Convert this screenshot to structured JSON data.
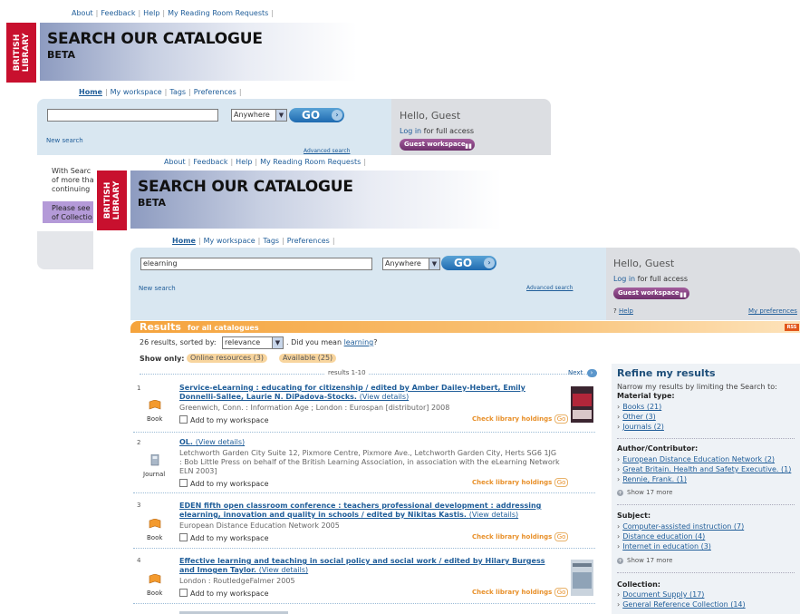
{
  "top_links": [
    "About",
    "Feedback",
    "Help",
    "My Reading Room Requests"
  ],
  "logo_text": "BRITISH LIBRARY",
  "banner": {
    "title": "SEARCH OUR CATALOGUE",
    "subtitle": "BETA"
  },
  "nav": [
    "Home",
    "My workspace",
    "Tags",
    "Preferences"
  ],
  "background_window": {
    "search_value": "",
    "scope_value": "Anywhere",
    "go_label": "GO",
    "new_search": "New search",
    "advanced_search": "Advanced search",
    "hello": "Hello, Guest",
    "login_link": "Log in",
    "login_suffix": " for full access",
    "guest_workspace": "Guest workspace",
    "intro_lines": [
      "With Searc",
      "of more tha",
      "continuing"
    ],
    "intro_box": [
      "Please see",
      "of Collectio"
    ]
  },
  "search": {
    "query": "elearning",
    "scope": "Anywhere",
    "go_label": "GO",
    "new_search": "New search",
    "advanced_search": "Advanced search"
  },
  "guest": {
    "hello": "Hello, Guest",
    "login_link": "Log in",
    "login_suffix": " for full access",
    "workspace_button": "Guest workspace",
    "help": "Help",
    "my_preferences": "My preferences"
  },
  "results": {
    "heading": "Results",
    "scope": "for all catalogues",
    "rss": "RSS",
    "count_prefix": "26 results, sorted by:",
    "sort_value": "relevance",
    "did_you_mean_prefix": ". Did you mean",
    "did_you_mean_link": "learning",
    "did_you_mean_suffix": "?",
    "show_only": "Show only:",
    "filters": [
      "Online resources (3)",
      "Available (25)"
    ],
    "range": "results 1-10",
    "next": "Next",
    "add_label": "Add to my workspace",
    "holdings_label": "Check library holdings",
    "holdings_go": "Go",
    "items": [
      {
        "num": "1",
        "title": "Service-eLearning : educating for citizenship / edited by Amber Dailey-Hebert, Emily Donnelli-Sallee, Laurie N. DiPadova-Stocks.",
        "view": "(View details)",
        "meta": "Greenwich, Conn. : Information Age ; London : Eurospan [distributor] 2008",
        "type": "Book"
      },
      {
        "num": "2",
        "title": "OL.",
        "view": "(View details)",
        "meta": "Letchworth Garden City Suite 12, Pixmore Centre, Pixmore Ave., Letchworth Garden City, Herts SG6 1JG : Bob Little Press on behalf of the British Learning Association, in association with the eLearning Network ELN 2003]",
        "type": "Journal"
      },
      {
        "num": "3",
        "title": "EDEN fifth open classroom conference : teachers professional development : addressing elearning, innovation and quality in schools / edited by Nikitas Kastis.",
        "view": "(View details)",
        "meta": "European Distance Education Network 2005",
        "type": "Book"
      },
      {
        "num": "4",
        "title": "Effective learning and teaching in social policy and social work / edited by Hilary Burgess and Imogen Taylor.",
        "view": "(View details)",
        "meta": "London : RoutledgeFalmer 2005",
        "type": "Book"
      }
    ]
  },
  "refine": {
    "title": "Refine my results",
    "desc": "Narrow my results by limiting the Search to:",
    "material_type": {
      "label": "Material type:",
      "items": [
        "Books (21)",
        "Other (3)",
        "Journals (2)"
      ]
    },
    "author": {
      "label": "Author/Contributor:",
      "items": [
        "European Distance Education Network (2)",
        "Great Britain. Health and Safety Executive. (1)",
        "Rennie, Frank. (1)"
      ],
      "more": "Show 17 more"
    },
    "subject": {
      "label": "Subject:",
      "items": [
        "Computer-assisted instruction (7)",
        "Distance education (4)",
        "Internet in education (3)"
      ],
      "more": "Show 17 more"
    },
    "collection": {
      "label": "Collection:",
      "items": [
        "Document Supply (17)",
        "General Reference Collection (14)"
      ]
    }
  },
  "colors": {
    "accent": "#1f5d99",
    "results_orange": "#f5a33c",
    "logo_red": "#c8102e",
    "guest_purple": "#7a3a76"
  }
}
